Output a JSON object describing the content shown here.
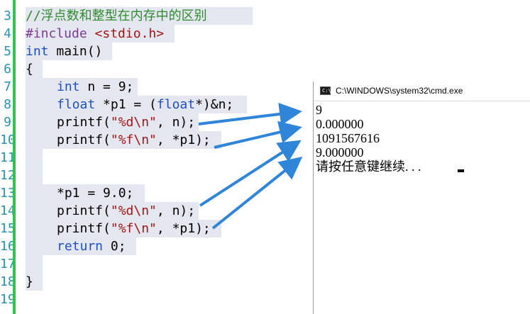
{
  "editor": {
    "line_numbers": [
      "3",
      "4",
      "5",
      "6",
      "7",
      "8",
      "9",
      "10",
      "11",
      "12",
      "13",
      "14",
      "15",
      "16",
      "17",
      "18",
      "19"
    ],
    "lines": {
      "l3_comment": "//浮点数和整型在内存中的区别",
      "l4_include": "#include",
      "l4_header": "<stdio.h>",
      "l5_type": "int",
      "l5_rest": " main()",
      "l6_brace": "{",
      "l7_type": "int",
      "l7_rest": " n = 9;",
      "l8_type": "float",
      "l8_mid": " *p1 = (",
      "l8_type2": "float",
      "l8_rest": "*)&n;",
      "l9_fn": "printf(",
      "l9_str": "\"%d\\n\"",
      "l9_rest": ", n);",
      "l10_fn": "printf(",
      "l10_str": "\"%f\\n\"",
      "l10_rest": ", *p1);",
      "l13_stmt": "*p1 = 9.0;",
      "l14_fn": "printf(",
      "l14_str": "\"%d\\n\"",
      "l14_rest": ", n);",
      "l15_fn": "printf(",
      "l15_str": "\"%f\\n\"",
      "l15_rest": ", *p1);",
      "l16_kw": "return",
      "l16_rest": " 0;",
      "l18_brace": "}"
    }
  },
  "console": {
    "title": "C:\\WINDOWS\\system32\\cmd.exe",
    "icon": "cmd-icon",
    "icon_prompt": "C:\\",
    "output": [
      "9",
      "0.000000",
      "1091567616",
      "9.000000",
      "请按任意键继续. . ."
    ]
  },
  "colors": {
    "arrow": "#2f86d8",
    "gutter_bar": "#33c24a",
    "line_number": "#2b91af",
    "comment": "#2e8b2e",
    "keyword": "#1f4fbf",
    "string": "#a31515",
    "preprocessor": "#7b3c91",
    "highlight": "#e4e7ef"
  }
}
